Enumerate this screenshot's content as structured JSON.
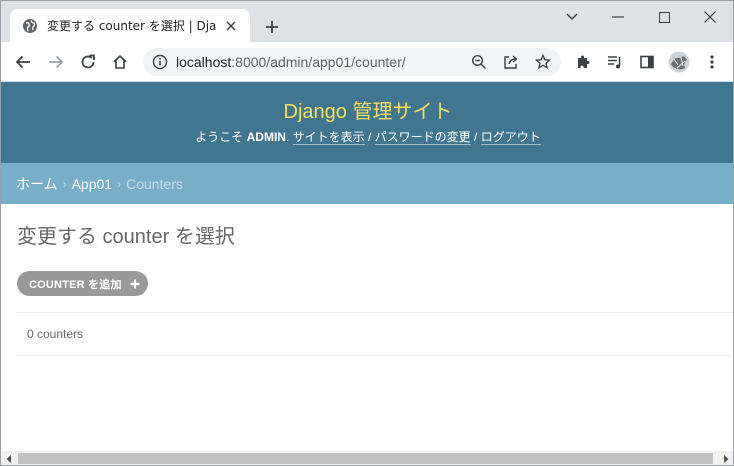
{
  "browser": {
    "tab_title": "変更する counter を選択 | Django",
    "url_host": "localhost",
    "url_rest": ":8000/admin/app01/counter/"
  },
  "site": {
    "branding": "Django 管理サイト",
    "welcome": "ようこそ",
    "username": "ADMIN",
    "view_site": "サイトを表示",
    "change_password": "パスワードの変更",
    "logout": "ログアウト",
    "separator": "/"
  },
  "breadcrumbs": {
    "home": "ホーム",
    "app": "App01",
    "current": "Counters",
    "sep": "›"
  },
  "content": {
    "title": "変更する counter を選択",
    "add_button": "COUNTER を追加",
    "result_count": "0 counters"
  },
  "colors": {
    "header_bg": "#417690",
    "branding": "#f5dd5d",
    "breadcrumbs_bg": "#79aec8",
    "add_button_bg": "#999999"
  }
}
